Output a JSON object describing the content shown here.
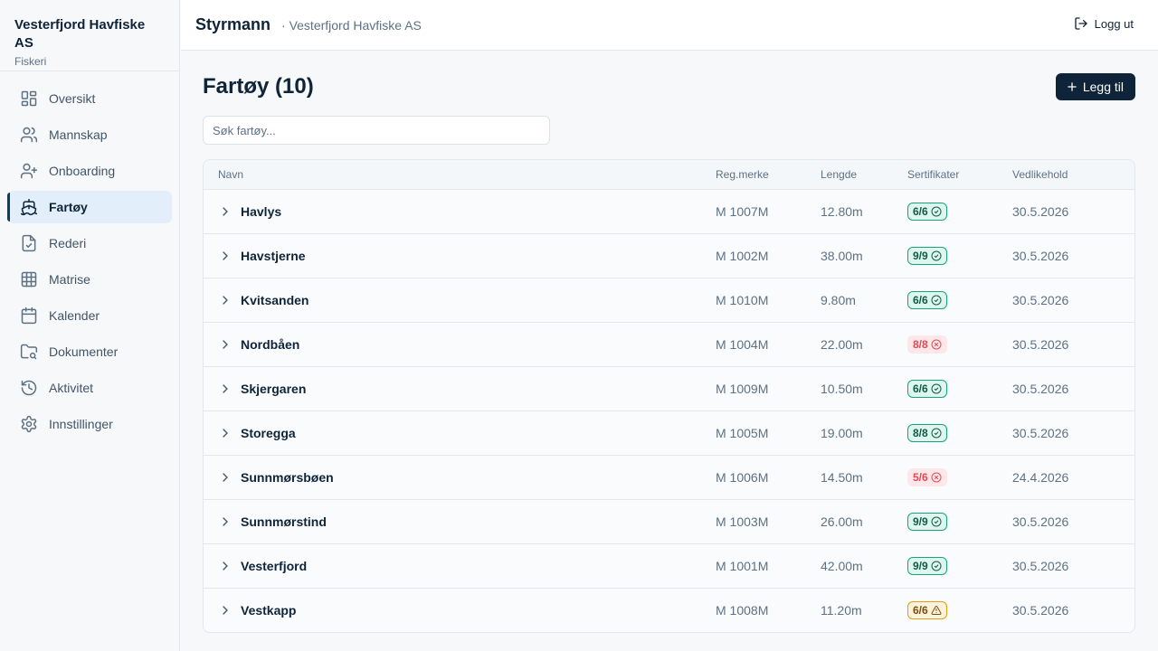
{
  "sidebar": {
    "org_name": "Vesterfjord Havfiske AS",
    "org_sub": "Fiskeri",
    "items": [
      {
        "label": "Oversikt",
        "icon": "dashboard-icon"
      },
      {
        "label": "Mannskap",
        "icon": "users-icon"
      },
      {
        "label": "Onboarding",
        "icon": "user-plus-icon"
      },
      {
        "label": "Fartøy",
        "icon": "ship-icon",
        "active": true
      },
      {
        "label": "Rederi",
        "icon": "file-check-icon"
      },
      {
        "label": "Matrise",
        "icon": "grid-icon"
      },
      {
        "label": "Kalender",
        "icon": "calendar-icon"
      },
      {
        "label": "Dokumenter",
        "icon": "folder-search-icon"
      },
      {
        "label": "Aktivitet",
        "icon": "history-icon"
      },
      {
        "label": "Innstillinger",
        "icon": "gear-icon"
      }
    ]
  },
  "header": {
    "title": "Styrmann",
    "subtitle": "· Vesterfjord Havfiske AS",
    "logout_label": "Logg ut"
  },
  "main": {
    "title": "Fartøy (10)",
    "add_label": "Legg til",
    "search_placeholder": "Søk fartøy...",
    "columns": {
      "name": "Navn",
      "reg": "Reg.merke",
      "length": "Lengde",
      "certs": "Sertifikater",
      "maintenance": "Vedlikehold"
    },
    "rows": [
      {
        "name": "Havlys",
        "reg": "M 1007M",
        "length": "12.80m",
        "certs": "6/6",
        "status": "ok",
        "maintenance": "30.5.2026"
      },
      {
        "name": "Havstjerne",
        "reg": "M 1002M",
        "length": "38.00m",
        "certs": "9/9",
        "status": "ok",
        "maintenance": "30.5.2026"
      },
      {
        "name": "Kvitsanden",
        "reg": "M 1010M",
        "length": "9.80m",
        "certs": "6/6",
        "status": "ok",
        "maintenance": "30.5.2026"
      },
      {
        "name": "Nordbåen",
        "reg": "M 1004M",
        "length": "22.00m",
        "certs": "8/8",
        "status": "bad",
        "maintenance": "30.5.2026"
      },
      {
        "name": "Skjergaren",
        "reg": "M 1009M",
        "length": "10.50m",
        "certs": "6/6",
        "status": "ok",
        "maintenance": "30.5.2026"
      },
      {
        "name": "Storegga",
        "reg": "M 1005M",
        "length": "19.00m",
        "certs": "8/8",
        "status": "ok",
        "maintenance": "30.5.2026"
      },
      {
        "name": "Sunnmørsbøen",
        "reg": "M 1006M",
        "length": "14.50m",
        "certs": "5/6",
        "status": "bad",
        "maintenance": "24.4.2026"
      },
      {
        "name": "Sunnmørstind",
        "reg": "M 1003M",
        "length": "26.00m",
        "certs": "9/9",
        "status": "ok",
        "maintenance": "30.5.2026"
      },
      {
        "name": "Vesterfjord",
        "reg": "M 1001M",
        "length": "42.00m",
        "certs": "9/9",
        "status": "ok",
        "maintenance": "30.5.2026"
      },
      {
        "name": "Vestkapp",
        "reg": "M 1008M",
        "length": "11.20m",
        "certs": "6/6",
        "status": "warn",
        "maintenance": "30.5.2026"
      }
    ]
  },
  "colors": {
    "primary": "#0f2438",
    "ok": "#18a37a",
    "bad": "#e04b57",
    "warn": "#e59a1a",
    "active_nav_bg": "#e2eef9"
  }
}
